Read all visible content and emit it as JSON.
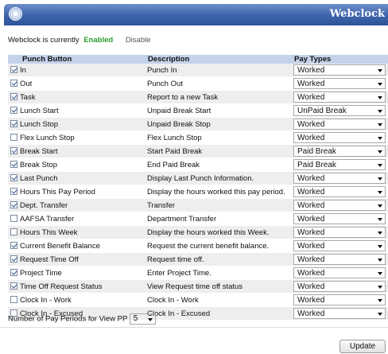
{
  "app": {
    "title": "Webclock"
  },
  "status": {
    "prefix": "Webclock is currently",
    "state": "Enabled",
    "disable_link": "Disable"
  },
  "table": {
    "headers": {
      "punch": "Punch Button",
      "description": "Description",
      "pay": "Pay Types"
    },
    "rows": [
      {
        "name": "In",
        "description": "Punch In",
        "pay": "Worked",
        "checked": true
      },
      {
        "name": "Out",
        "description": "Punch Out",
        "pay": "Worked",
        "checked": true
      },
      {
        "name": "Task",
        "description": "Report to a new Task",
        "pay": "Worked",
        "checked": true
      },
      {
        "name": "Lunch Start",
        "description": "Unpaid Break Start",
        "pay": "UnPaid Break",
        "checked": true
      },
      {
        "name": "Lunch Stop",
        "description": "Unpaid Break Stop",
        "pay": "Worked",
        "checked": true
      },
      {
        "name": "Flex Lunch Stop",
        "description": "Flex Lunch Stop",
        "pay": "Worked",
        "checked": false
      },
      {
        "name": "Break Start",
        "description": "Start Paid Break",
        "pay": "Paid Break",
        "checked": true
      },
      {
        "name": "Break Stop",
        "description": "End Paid Break",
        "pay": "Paid Break",
        "checked": true
      },
      {
        "name": "Last Punch",
        "description": "Display Last Punch Information.",
        "pay": "Worked",
        "checked": true
      },
      {
        "name": "Hours This Pay Period",
        "description": "Display the hours worked this pay period.",
        "pay": "Worked",
        "checked": true
      },
      {
        "name": "Dept. Transfer",
        "description": "Transfer",
        "pay": "Worked",
        "checked": true
      },
      {
        "name": "AAFSA Transfer",
        "description": "Department Transfer",
        "pay": "Worked",
        "checked": false
      },
      {
        "name": "Hours This Week",
        "description": "Display the hours worked this Week.",
        "pay": "Worked",
        "checked": false
      },
      {
        "name": "Current Benefit Balance",
        "description": "Request the current benefit balance.",
        "pay": "Worked",
        "checked": true
      },
      {
        "name": "Request Time Off",
        "description": "Request time off.",
        "pay": "Worked",
        "checked": true
      },
      {
        "name": "Project Time",
        "description": "Enter Project Time.",
        "pay": "Worked",
        "checked": true
      },
      {
        "name": "Time Off Request Status",
        "description": "View Request time off status",
        "pay": "Worked",
        "checked": true
      },
      {
        "name": "Clock In - Work",
        "description": "Clock In - Work",
        "pay": "Worked",
        "checked": false
      },
      {
        "name": "Clock In - Excused",
        "description": "Clock In - Excused",
        "pay": "Worked",
        "checked": false
      }
    ]
  },
  "pay_periods": {
    "label": "Number of Pay Periods for View PP",
    "value": "5"
  },
  "actions": {
    "update_label": "Update"
  },
  "colors": {
    "header_bar": "#3d63aa",
    "enabled": "#2a9a2a",
    "table_header": "#c4d2ea"
  }
}
